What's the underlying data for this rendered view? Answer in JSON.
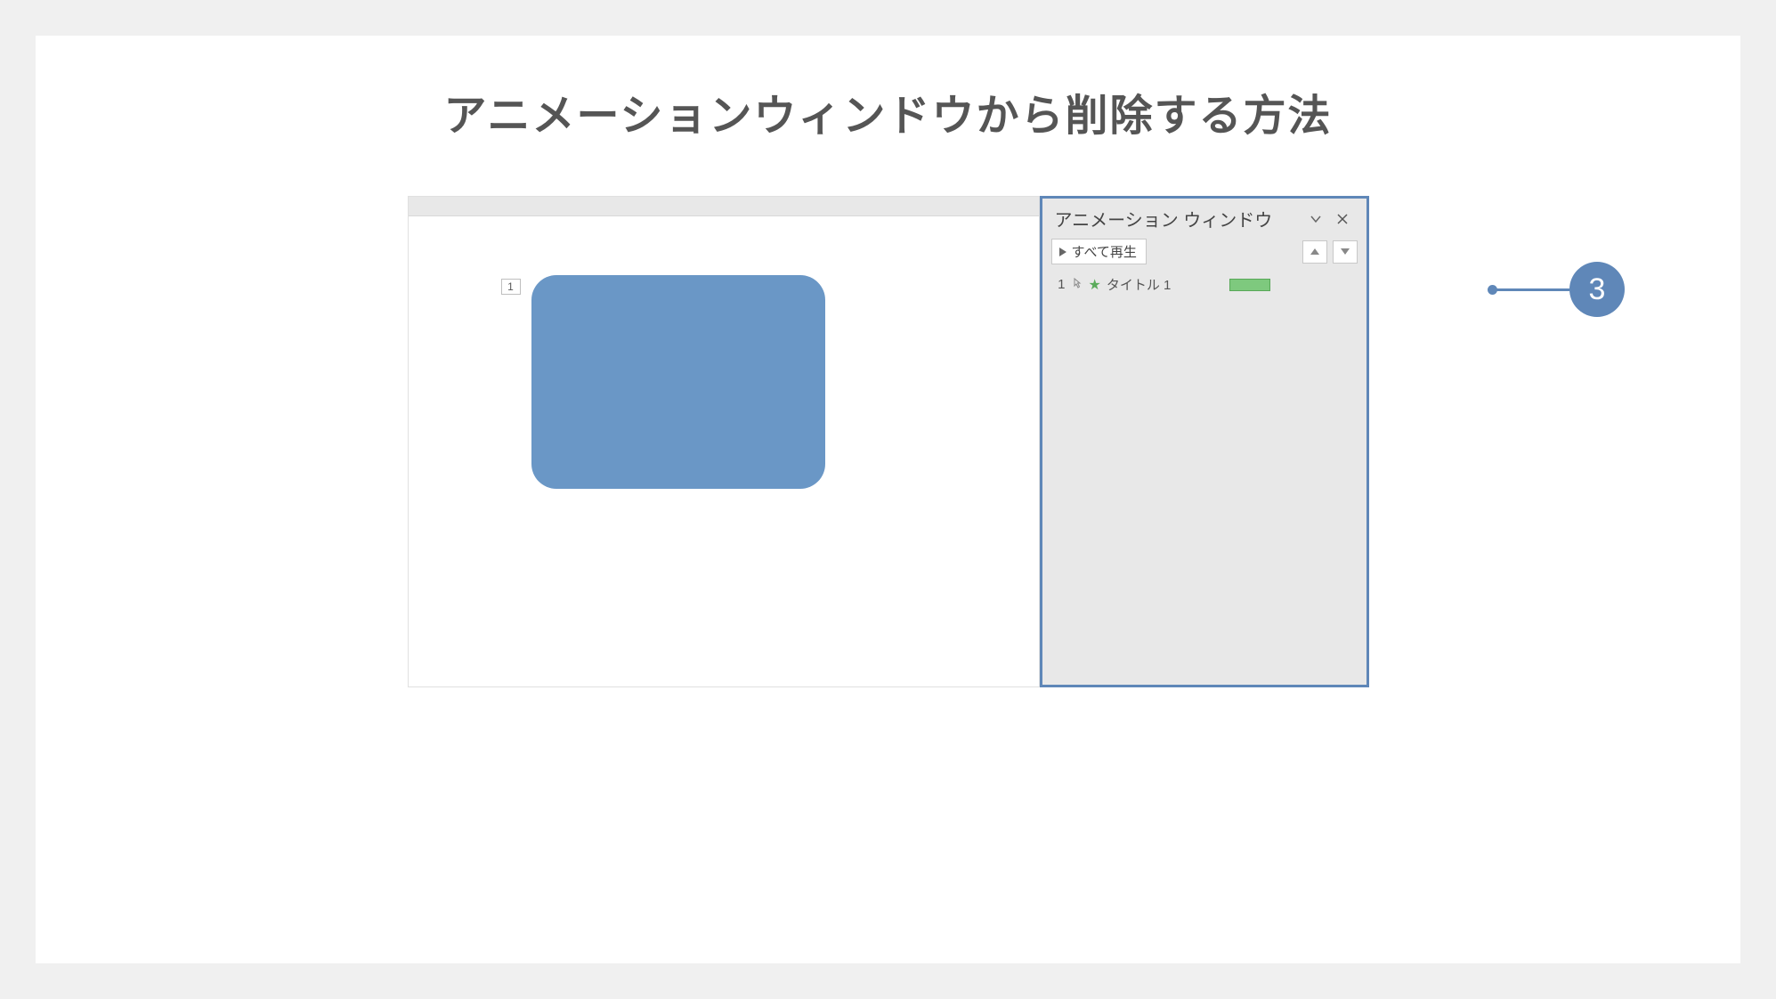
{
  "title": "アニメーションウィンドウから削除する方法",
  "slide": {
    "animation_tag": "1"
  },
  "pane": {
    "header_title": "アニメーション ウィンドウ",
    "play_all": "すべて再生",
    "items": [
      {
        "index": "1",
        "label": "タイトル 1"
      }
    ]
  },
  "callout": {
    "number": "3"
  }
}
